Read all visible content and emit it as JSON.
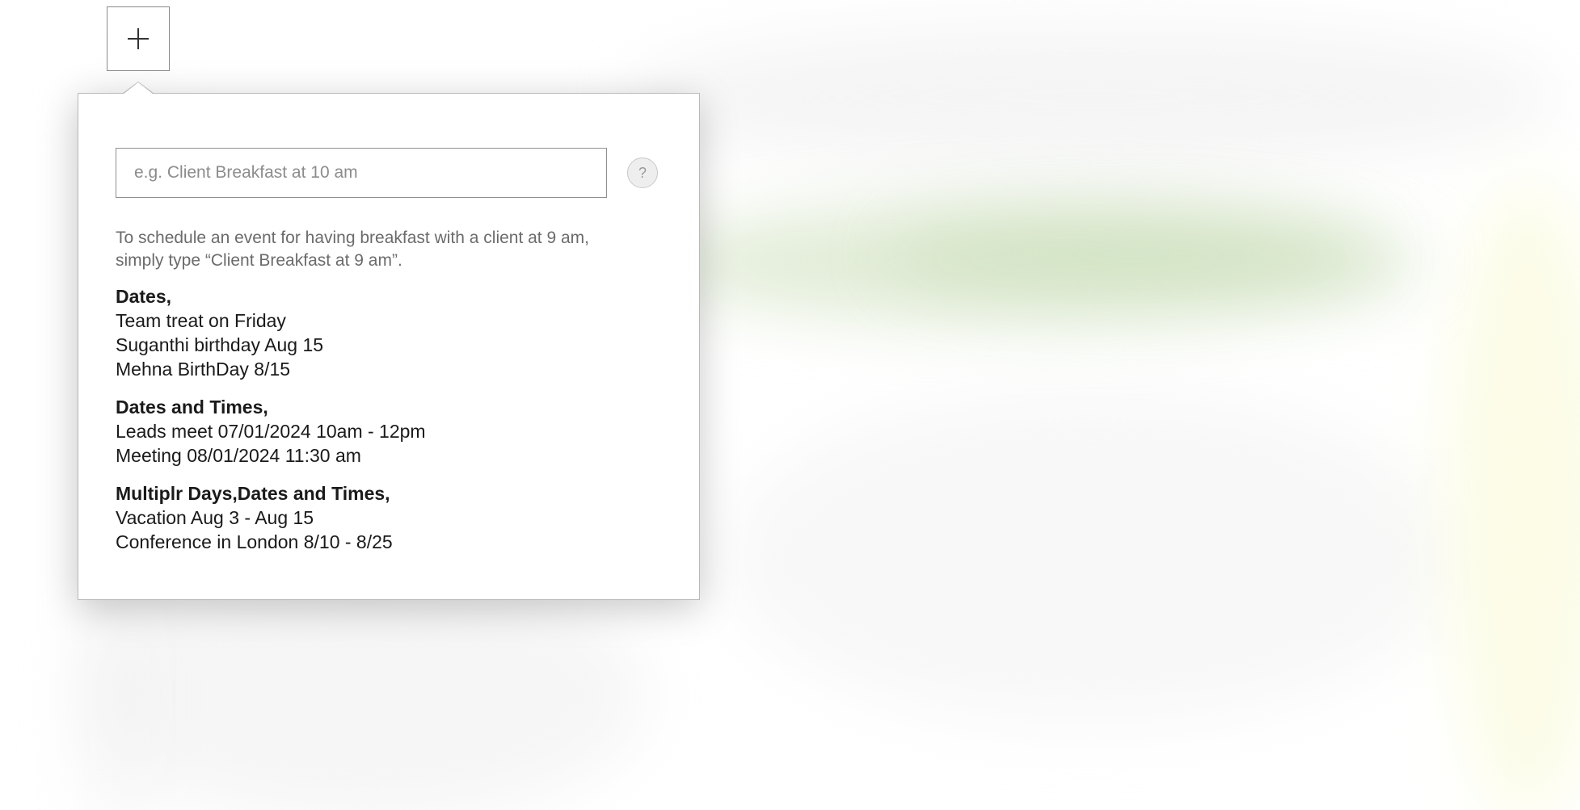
{
  "toolbar": {
    "add_icon": "plus-icon"
  },
  "popover": {
    "input": {
      "placeholder": "e.g. Client Breakfast at 10 am",
      "value": ""
    },
    "help_label": "?",
    "hint": "To schedule an event for having breakfast with a client at 9 am, simply type “Client Breakfast at 9 am”.",
    "examples": [
      {
        "heading": "Dates,",
        "lines": [
          "Team treat on Friday",
          "Suganthi birthday Aug 15",
          "Mehna BirthDay 8/15"
        ]
      },
      {
        "heading": "Dates and Times,",
        "lines": [
          "Leads meet 07/01/2024 10am - 12pm",
          "Meeting 08/01/2024 11:30 am"
        ]
      },
      {
        "heading": "Multiplr  Days,Dates and Times,",
        "lines": [
          "Vacation Aug 3 - Aug 15",
          "Conference in London 8/10 - 8/25"
        ]
      }
    ]
  },
  "colors": {
    "border": "#8a8a8a",
    "hint_text": "#6b6b6b",
    "body_text": "#1a1a1a"
  }
}
